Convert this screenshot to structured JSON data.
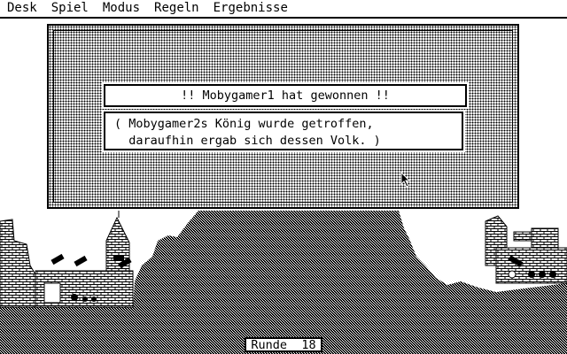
{
  "menubar": {
    "items": [
      "Desk",
      "Spiel",
      "Modus",
      "Regeln",
      "Ergebnisse"
    ]
  },
  "dialog": {
    "title": "!! Mobygamer1 hat gewonnen !!",
    "message": "( Mobygamer2s König wurde getroffen,\n  daraufhin ergab sich dessen Volk. )"
  },
  "status": {
    "round_label": "Runde",
    "round_number": "18",
    "round_text": "Runde  18"
  },
  "colors": {
    "foreground": "#000000",
    "background": "#ffffff"
  }
}
